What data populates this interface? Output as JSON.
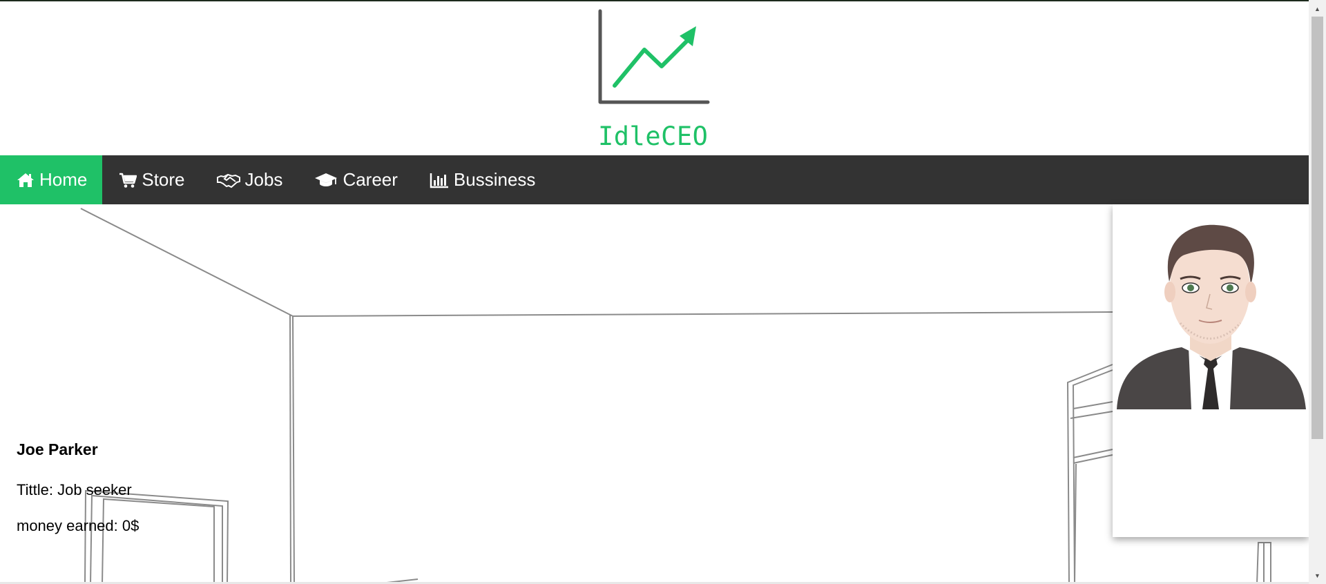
{
  "logo": {
    "text": "IdleCEO",
    "icon": "rising-chart-icon",
    "accent_color": "#1fc167",
    "axis_color": "#555555"
  },
  "nav": {
    "background": "#333333",
    "active_color": "#1fc167",
    "items": [
      {
        "label": "Home",
        "icon": "home-icon",
        "active": true
      },
      {
        "label": "Store",
        "icon": "cart-icon",
        "active": false
      },
      {
        "label": "Jobs",
        "icon": "handshake-icon",
        "active": false
      },
      {
        "label": "Career",
        "icon": "graduation-cap-icon",
        "active": false
      },
      {
        "label": "Bussiness",
        "icon": "bar-chart-icon",
        "active": false
      }
    ]
  },
  "profile": {
    "name": "Joe Parker",
    "title": "Tittle: Job seeker",
    "money": "money earned: 0$"
  }
}
